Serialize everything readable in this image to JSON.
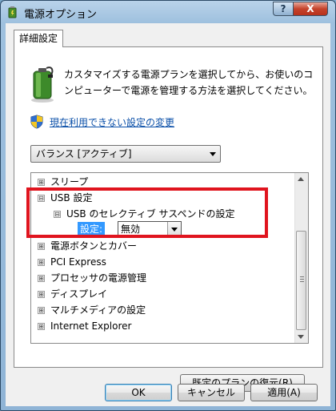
{
  "window": {
    "title": "電源オプション"
  },
  "caption_buttons": {
    "help": "?",
    "close": "X"
  },
  "tab": {
    "label": "詳細設定"
  },
  "intro": {
    "text": "カスタマイズする電源プランを選択してから、お使いのコンピューターで電源を管理する方法を選択してください。"
  },
  "link": {
    "unavailable_settings": "現在利用できない設定の変更"
  },
  "plan_select": {
    "value": "バランス [アクティブ]"
  },
  "tree": {
    "items": [
      {
        "expander": "⊞",
        "label": "スリープ"
      },
      {
        "expander": "⊟",
        "label": "USB 設定"
      },
      {
        "expander": "⊟",
        "label": "USB のセレクティブ サスペンドの設定"
      },
      {
        "expander": "⊞",
        "label": "電源ボタンとカバー"
      },
      {
        "expander": "⊞",
        "label": "PCI Express"
      },
      {
        "expander": "⊞",
        "label": "プロセッサの電源管理"
      },
      {
        "expander": "⊞",
        "label": "ディスプレイ"
      },
      {
        "expander": "⊞",
        "label": "マルチメディアの設定"
      },
      {
        "expander": "⊞",
        "label": "Internet Explorer"
      }
    ],
    "setting": {
      "label": "設定:",
      "value": "無効"
    }
  },
  "buttons": {
    "restore": "既定のプランの復元(R)",
    "ok": "OK",
    "cancel": "キャンセル",
    "apply": "適用(A)"
  },
  "colors": {
    "highlight_box": "#e0141e",
    "selection": "#3399ff",
    "link": "#0a4fa8"
  }
}
